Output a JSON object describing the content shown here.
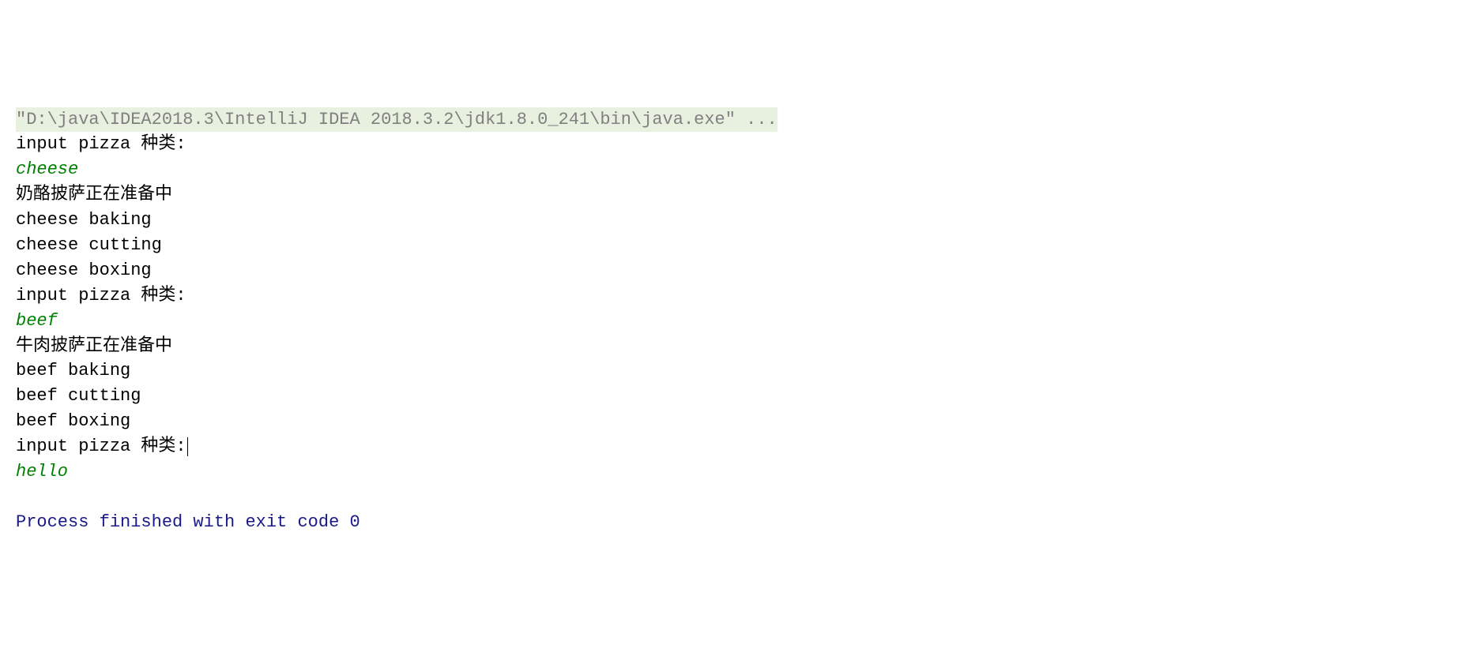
{
  "console": {
    "command": "\"D:\\java\\IDEA2018.3\\IntelliJ IDEA 2018.3.2\\jdk1.8.0_241\\bin\\java.exe\" ...",
    "lines": [
      {
        "type": "output",
        "text": "input pizza 种类:"
      },
      {
        "type": "input",
        "text": "cheese"
      },
      {
        "type": "output",
        "text": "奶酪披萨正在准备中"
      },
      {
        "type": "output",
        "text": "cheese baking"
      },
      {
        "type": "output",
        "text": "cheese cutting"
      },
      {
        "type": "output",
        "text": "cheese boxing"
      },
      {
        "type": "output",
        "text": "input pizza 种类:"
      },
      {
        "type": "input",
        "text": "beef"
      },
      {
        "type": "output",
        "text": "牛肉披萨正在准备中"
      },
      {
        "type": "output",
        "text": "beef baking"
      },
      {
        "type": "output",
        "text": "beef cutting"
      },
      {
        "type": "output",
        "text": "beef boxing"
      },
      {
        "type": "output",
        "text": "input pizza 种类:",
        "cursor": true
      },
      {
        "type": "input",
        "text": "hello"
      }
    ],
    "exit_message": "Process finished with exit code 0"
  }
}
